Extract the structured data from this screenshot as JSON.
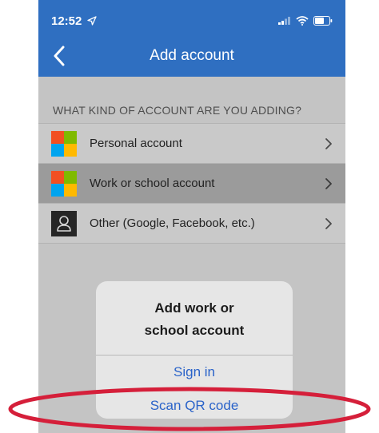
{
  "status_bar": {
    "time": "12:52"
  },
  "nav": {
    "title": "Add account"
  },
  "section": {
    "header": "WHAT KIND OF ACCOUNT ARE YOU ADDING?"
  },
  "accounts": [
    {
      "label": "Personal account"
    },
    {
      "label": "Work or school account"
    },
    {
      "label": "Other (Google, Facebook, etc.)"
    }
  ],
  "dialog": {
    "title_line1": "Add work or",
    "title_line2": "school account",
    "sign_in": "Sign in",
    "scan_qr": "Scan QR code"
  },
  "colors": {
    "brand_blue": "#2f6fc1",
    "action_blue": "#2a63c9",
    "highlight_red": "#d51f3a",
    "ms_red": "#f25022",
    "ms_green": "#7fba00",
    "ms_blue": "#00a4ef",
    "ms_yellow": "#ffb900"
  },
  "icons": {
    "back": "chevron-left-icon",
    "row_chevron": "chevron-right-icon",
    "signal": "signal-icon",
    "wifi": "wifi-icon",
    "battery": "battery-icon",
    "location": "location-arrow-icon"
  }
}
